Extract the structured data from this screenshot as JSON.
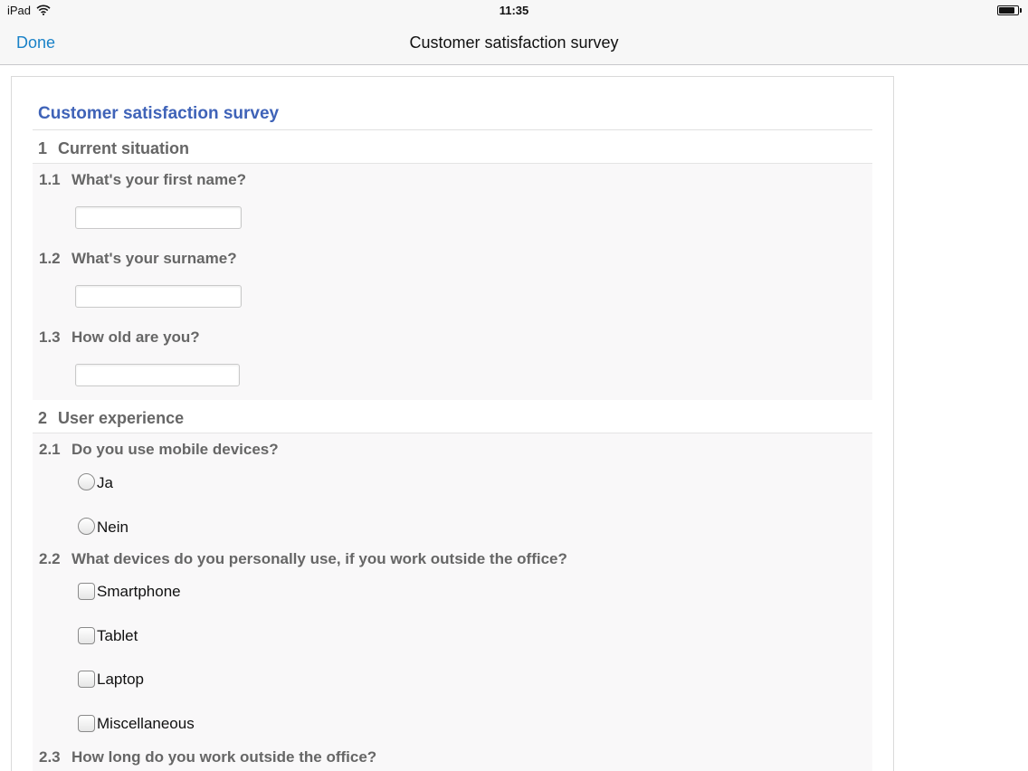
{
  "status_bar": {
    "device": "iPad",
    "time": "11:35",
    "wifi_icon": "wifi-icon",
    "battery_icon": "battery-icon",
    "battery_level": 0.85
  },
  "nav": {
    "done_label": "Done",
    "title": "Customer satisfaction survey",
    "accent_color": "#1a82c8"
  },
  "survey": {
    "title": "Customer satisfaction survey",
    "title_color": "#3f63b8",
    "sections": [
      {
        "number": "1",
        "title": "Current situation",
        "questions": [
          {
            "number": "1.1",
            "text": "What's your first name?",
            "type": "text",
            "value": ""
          },
          {
            "number": "1.2",
            "text": "What's your surname?",
            "type": "text",
            "value": ""
          },
          {
            "number": "1.3",
            "text": "How old are you?",
            "type": "text",
            "value": ""
          }
        ]
      },
      {
        "number": "2",
        "title": "User experience",
        "questions": [
          {
            "number": "2.1",
            "text": "Do you use mobile devices?",
            "type": "radio",
            "options": [
              "Ja",
              "Nein"
            ]
          },
          {
            "number": "2.2",
            "text": "What devices do you personally use, if you work outside the office?",
            "type": "checkbox",
            "options": [
              "Smartphone",
              "Tablet",
              "Laptop",
              "Miscellaneous"
            ]
          },
          {
            "number": "2.3",
            "text": "How long do you work outside the office?",
            "type": "unknown"
          }
        ]
      }
    ]
  }
}
